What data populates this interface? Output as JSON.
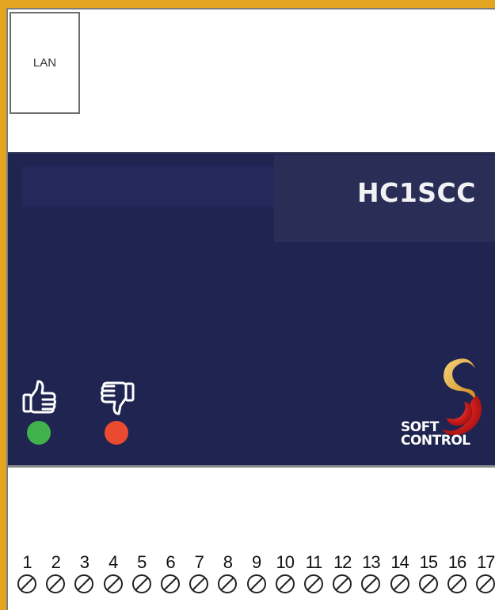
{
  "device": {
    "port_label": "LAN",
    "model": "HC1SCC",
    "logo_line1": "SOFT",
    "logo_line2": "CONTROL"
  },
  "indicators": [
    {
      "icon": "thumbs-up-icon",
      "led_color": "#41b24b"
    },
    {
      "icon": "thumbs-down-icon",
      "led_color": "#ea4a2f"
    }
  ],
  "terminals": [
    "1",
    "2",
    "3",
    "4",
    "5",
    "6",
    "7",
    "8",
    "9",
    "10",
    "11",
    "12",
    "13",
    "14",
    "15",
    "16",
    "17"
  ],
  "colors": {
    "background": "#e3a51f",
    "panel": "#1f2450",
    "model_box": "#2a2e57"
  }
}
